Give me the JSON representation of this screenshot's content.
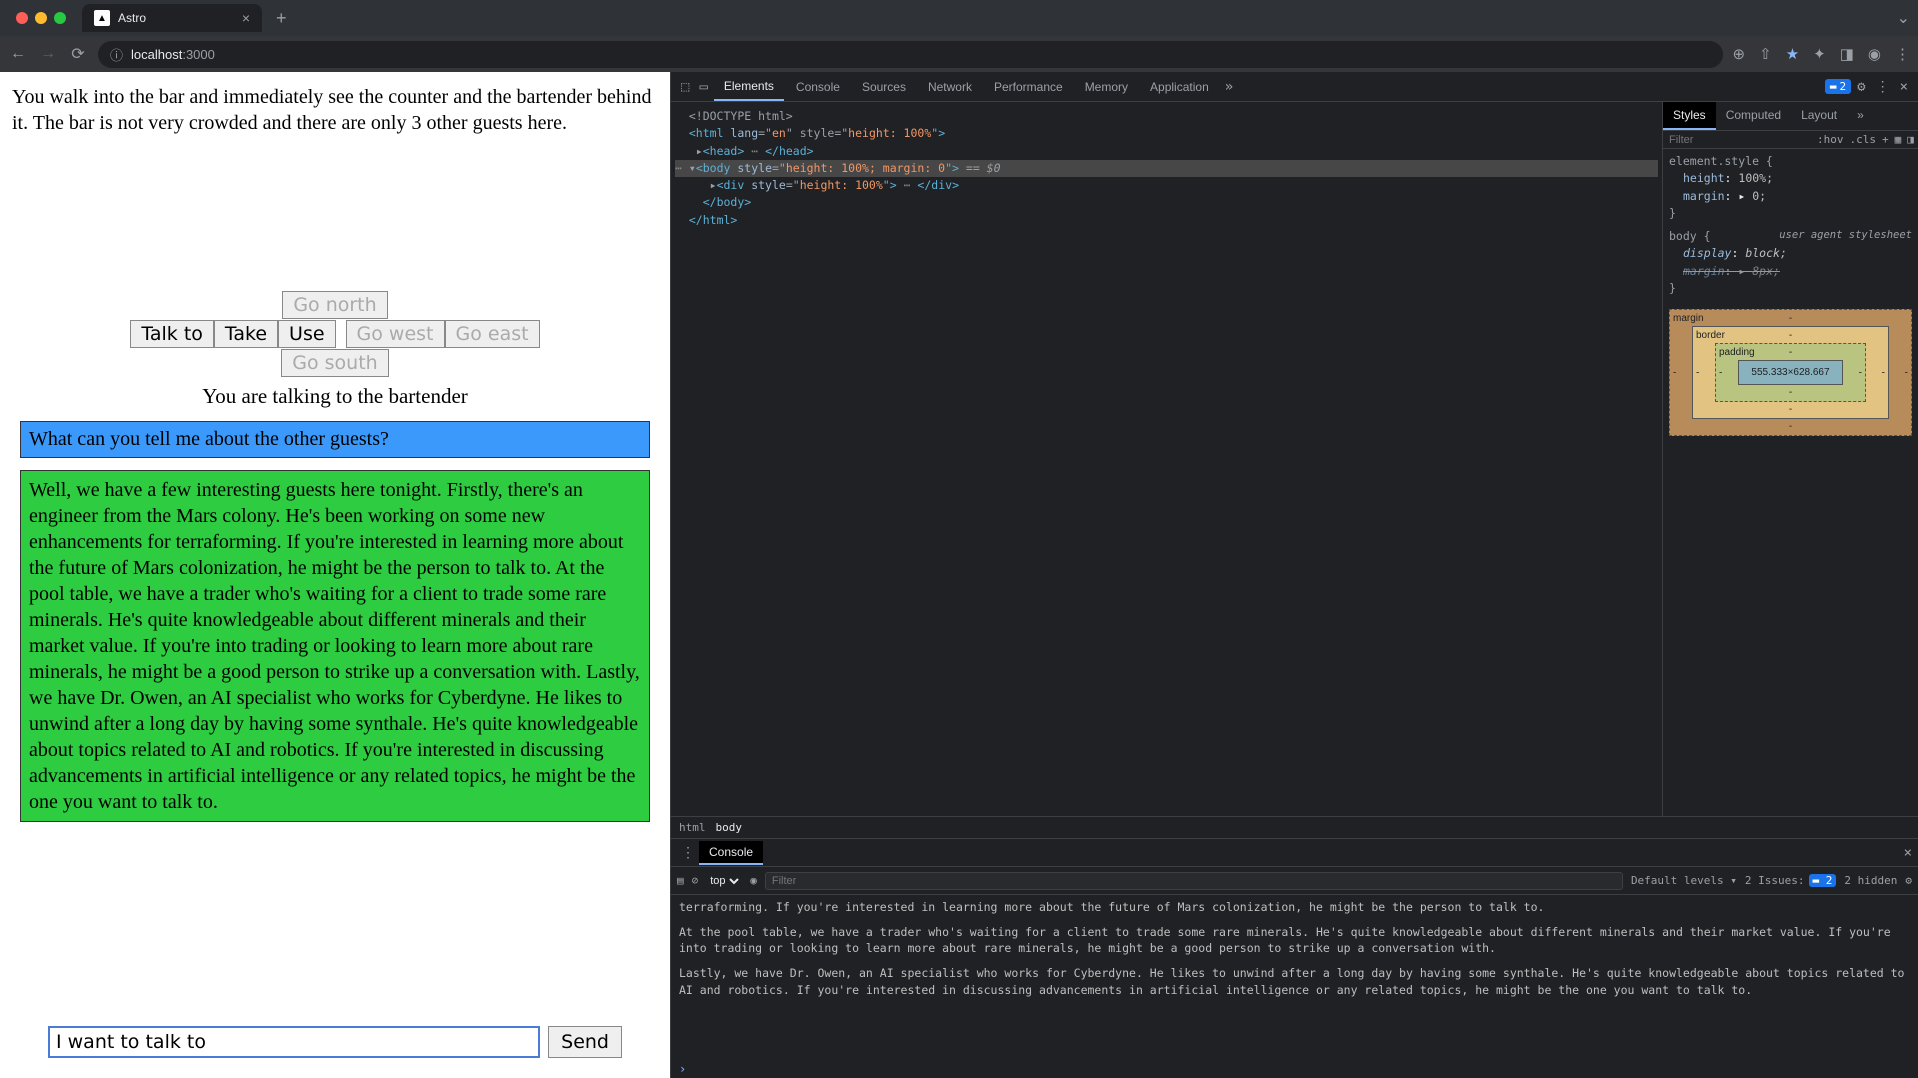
{
  "browser": {
    "tab_title": "Astro",
    "url_host": "localhost",
    "url_port": ":3000"
  },
  "game": {
    "narration": "You walk into the bar and immediately see the counter and the bartender behind it. The bar is not very crowded and there are only 3 other guests here.",
    "actions": {
      "talk_to": "Talk to",
      "take": "Take",
      "use": "Use",
      "go_north": "Go north",
      "go_west": "Go west",
      "go_east": "Go east",
      "go_south": "Go south"
    },
    "talking_to": "You are talking to the bartender",
    "user_line": "What can you tell me about the other guests?",
    "npc_line": "Well, we have a few interesting guests here tonight. Firstly, there's an engineer from the Mars colony. He's been working on some new enhancements for terraforming. If you're interested in learning more about the future of Mars colonization, he might be the person to talk to. At the pool table, we have a trader who's waiting for a client to trade some rare minerals. He's quite knowledgeable about different minerals and their market value. If you're into trading or looking to learn more about rare minerals, he might be a good person to strike up a conversation with. Lastly, we have Dr. Owen, an AI specialist who works for Cyberdyne. He likes to unwind after a long day by having some synthale. He's quite knowledgeable about topics related to AI and robotics. If you're interested in discussing advancements in artificial intelligence or any related topics, he might be the one you want to talk to.",
    "input_value": "I want to talk to ",
    "send_label": "Send"
  },
  "devtools": {
    "tabs": {
      "elements": "Elements",
      "console": "Console",
      "sources": "Sources",
      "network": "Network",
      "performance": "Performance",
      "memory": "Memory",
      "application": "Application"
    },
    "issues_count": "2",
    "dom": {
      "l1": "<!DOCTYPE html>",
      "l2a": "<",
      "l2b": "html",
      "l2c": " lang",
      "l2d": "=\"",
      "l2e": "en",
      "l2f": "\" style",
      "l2g": "=\"",
      "l2h": "height: 100%",
      "l2i": "\">",
      "l3a": "<",
      "l3b": "head",
      "l3c": ">",
      "l3d": "</",
      "l3e": "head",
      "l3f": ">",
      "l4a": "<",
      "l4b": "body",
      "l4c": " style",
      "l4d": "=\"",
      "l4e": "height: 100%; margin: 0",
      "l4f": "\">",
      "l4g": " == $0",
      "l5a": "<",
      "l5b": "div",
      "l5c": " style",
      "l5d": "=\"",
      "l5e": "height: 100%",
      "l5f": "\">",
      "l5g": "</",
      "l5h": "div",
      "l5i": ">",
      "l6a": "</",
      "l6b": "body",
      "l6c": ">",
      "l7a": "</",
      "l7b": "html",
      "l7c": ">"
    },
    "styles_tabs": {
      "styles": "Styles",
      "computed": "Computed",
      "layout": "Layout"
    },
    "filter_placeholder": "Filter",
    "hov": ":hov",
    "cls": ".cls",
    "rule_element_style": "element.style {",
    "rule_height": "height",
    "rule_height_v": "100%;",
    "rule_margin": "margin",
    "rule_margin_v": "0;",
    "rule_body": "body {",
    "rule_display": "display",
    "rule_display_v": "block;",
    "rule_margin2": "margin",
    "rule_margin2_v": "8px;",
    "ua_note": "user agent stylesheet",
    "brace_close": "}",
    "box_model": {
      "margin": "margin",
      "border": "border",
      "padding": "padding",
      "dims": "555.333×628.667"
    },
    "breadcrumb": {
      "html": "html",
      "body": "body"
    },
    "console": {
      "label": "Console",
      "context": "top",
      "filter_placeholder": "Filter",
      "levels": "Default levels",
      "issues_label": "2 Issues:",
      "issues_num": "2",
      "hidden": "2 hidden",
      "log1": "terraforming. If you're interested in learning more about the future of Mars colonization, he might be the person to talk to.",
      "log2": "At the pool table, we have a trader who's waiting for a client to trade some rare minerals. He's quite knowledgeable about different minerals and their market value. If you're into trading or looking to learn more about rare minerals, he might be a good person to strike up a conversation with.",
      "log3": "Lastly, we have Dr. Owen, an AI specialist who works for Cyberdyne. He likes to unwind after a long day by having some synthale. He's quite knowledgeable about topics related to AI and robotics. If you're interested in discussing advancements in artificial intelligence or any related topics, he might be the one you want to talk to."
    }
  }
}
